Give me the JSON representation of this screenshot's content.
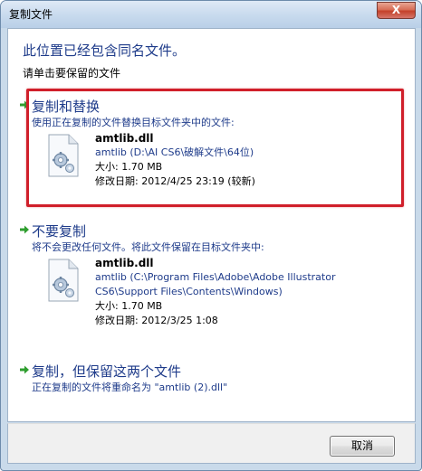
{
  "window": {
    "title": "复制文件",
    "close_label": "X"
  },
  "heading": "此位置已经包含同名文件。",
  "subheading": "请单击要保留的文件",
  "options": [
    {
      "title": "复制和替换",
      "description": "使用正在复制的文件替换目标文件夹中的文件:",
      "file": {
        "name": "amtlib.dll",
        "path_lines": [
          "amtlib (D:\\AI CS6\\破解文件\\64位)"
        ],
        "size": "大小: 1.70 MB",
        "modified": "修改日期: 2012/4/25 23:19 (较新)"
      }
    },
    {
      "title": "不要复制",
      "description": "将不会更改任何文件。将此文件保留在目标文件夹中:",
      "file": {
        "name": "amtlib.dll",
        "path_lines": [
          "amtlib (C:\\Program Files\\Adobe\\Adobe Illustrator",
          "CS6\\Support Files\\Contents\\Windows)"
        ],
        "size": "大小: 1.70 MB",
        "modified": "修改日期: 2012/3/25 1:08"
      }
    },
    {
      "title": "复制，但保留这两个文件",
      "description": "正在复制的文件将重命名为 \"amtlib (2).dll\""
    }
  ],
  "footer": {
    "cancel_label": "取消"
  },
  "colors": {
    "link_blue": "#1e3b8a",
    "arrow_green": "#2f9e2f",
    "highlight_red": "#d01f2a"
  },
  "icons": {
    "option_arrow": "green-arrow-icon",
    "file": "dll-file-gear-icon"
  }
}
